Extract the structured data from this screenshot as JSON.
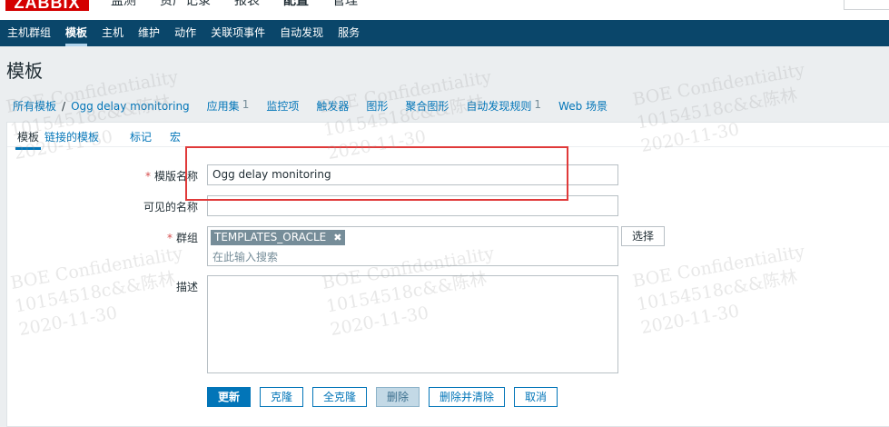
{
  "app": {
    "logo": "ZABBIX"
  },
  "top_nav": [
    "监测",
    "资产记录",
    "报表",
    "配置",
    "管理"
  ],
  "top_nav_active": "配置",
  "sub_nav": [
    "主机群组",
    "模板",
    "主机",
    "维护",
    "动作",
    "关联项事件",
    "自动发现",
    "服务"
  ],
  "sub_nav_active": "模板",
  "page_title": "模板",
  "breadcrumb": {
    "all_templates": "所有模板",
    "separator": "/",
    "current": "Ogg delay monitoring",
    "items": [
      {
        "label": "应用集",
        "count": "1"
      },
      {
        "label": "监控项",
        "count": ""
      },
      {
        "label": "触发器",
        "count": ""
      },
      {
        "label": "图形",
        "count": ""
      },
      {
        "label": "聚合图形",
        "count": ""
      },
      {
        "label": "自动发现规则",
        "count": "1"
      },
      {
        "label": "Web 场景",
        "count": ""
      }
    ]
  },
  "tabs": [
    "模板",
    "链接的模板",
    "标记",
    "宏"
  ],
  "form": {
    "template_name_label": "模版名称",
    "template_name_value": "Ogg delay monitoring",
    "visible_name_label": "可见的名称",
    "visible_name_value": "",
    "groups_label": "群组",
    "group_chip": "TEMPLATES_ORACLE",
    "group_chip_remove": "✖",
    "groups_placeholder": "在此输入搜索",
    "select_button": "选择",
    "description_label": "描述",
    "description_value": "",
    "required_mark": "*"
  },
  "buttons": {
    "update": "更新",
    "clone": "克隆",
    "full_clone": "全克隆",
    "delete": "删除",
    "delete_and_clear": "删除并清除",
    "cancel": "取消"
  },
  "watermark": {
    "line1": "BOE Confidentiality",
    "line2": "10154518c&&陈林",
    "line3": "2020-11-30"
  },
  "colors": {
    "header_bg": "#0a466a",
    "link": "#0275b8",
    "highlight_box": "#e03a3a",
    "logo": "#d40000"
  }
}
